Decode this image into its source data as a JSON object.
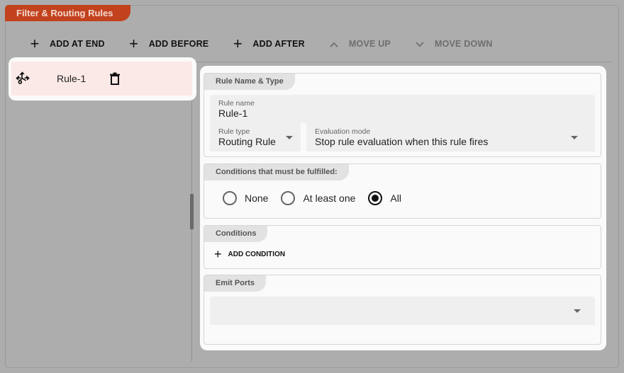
{
  "panel": {
    "title": "Filter & Routing Rules",
    "accent_color": "#c2421d"
  },
  "toolbar": {
    "buttons": [
      {
        "icon": "plus-icon",
        "label": "ADD AT END",
        "enabled": true
      },
      {
        "icon": "plus-icon",
        "label": "ADD BEFORE",
        "enabled": true
      },
      {
        "icon": "plus-icon",
        "label": "ADD AFTER",
        "enabled": true
      },
      {
        "icon": "chevron-up-icon",
        "label": "MOVE UP",
        "enabled": false
      },
      {
        "icon": "chevron-down-icon",
        "label": "MOVE DOWN",
        "enabled": false
      }
    ]
  },
  "rules": [
    {
      "name": "Rule-1",
      "selected": true,
      "drag_icon": "drag-move-icon",
      "delete_icon": "trash-icon"
    }
  ],
  "detail": {
    "name_type_section": {
      "title": "Rule Name & Type",
      "rule_name_label": "Rule name",
      "rule_name_value": "Rule-1",
      "rule_type_label": "Rule type",
      "rule_type_value": "Routing Rule",
      "eval_mode_label": "Evaluation mode",
      "eval_mode_value": "Stop rule evaluation when this rule fires"
    },
    "fulfill_section": {
      "title": "Conditions that must be fulfilled:",
      "options": [
        {
          "label": "None",
          "checked": false
        },
        {
          "label": "At least one",
          "checked": false
        },
        {
          "label": "All",
          "checked": true
        }
      ]
    },
    "conditions_section": {
      "title": "Conditions",
      "add_label": "ADD CONDITION"
    },
    "emit_ports_section": {
      "title": "Emit Ports",
      "value": ""
    }
  }
}
